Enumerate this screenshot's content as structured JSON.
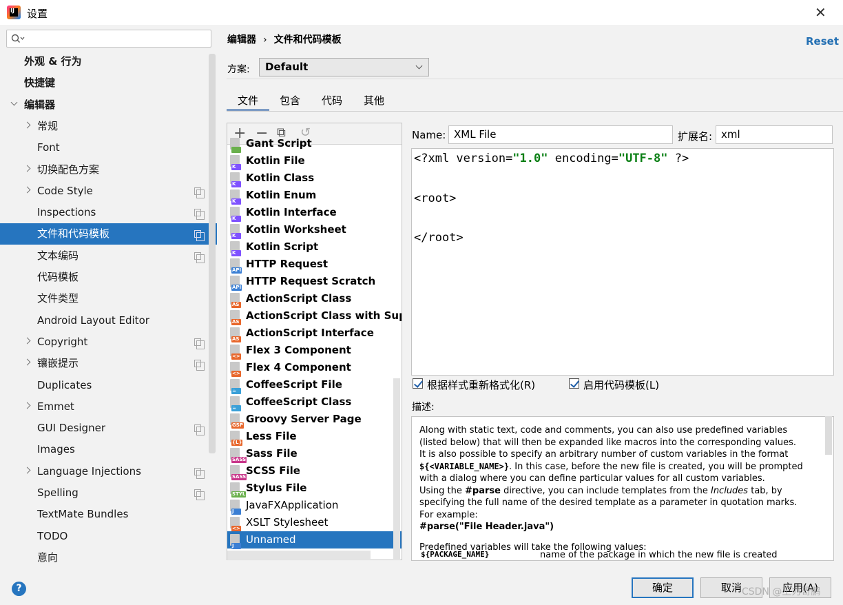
{
  "window": {
    "title": "设置",
    "close": "✕"
  },
  "search": {
    "placeholder": ""
  },
  "sidebar": {
    "items": [
      {
        "label": "外观 & 行为",
        "bold": true
      },
      {
        "label": "快捷键",
        "bold": true
      },
      {
        "label": "编辑器",
        "bold": true,
        "expanded": true
      },
      {
        "label": "常规",
        "expandable": true
      },
      {
        "label": "Font"
      },
      {
        "label": "切换配色方案",
        "expandable": true
      },
      {
        "label": "Code Style",
        "expandable": true,
        "copy": true
      },
      {
        "label": "Inspections",
        "copy": true
      },
      {
        "label": "文件和代码模板",
        "copy": true,
        "selected": true
      },
      {
        "label": "文本编码",
        "copy": true
      },
      {
        "label": "代码模板"
      },
      {
        "label": "文件类型"
      },
      {
        "label": "Android Layout Editor"
      },
      {
        "label": "Copyright",
        "expandable": true,
        "copy": true
      },
      {
        "label": "镶嵌提示",
        "expandable": true,
        "copy": true
      },
      {
        "label": "Duplicates"
      },
      {
        "label": "Emmet",
        "expandable": true
      },
      {
        "label": "GUI Designer",
        "copy": true
      },
      {
        "label": "Images"
      },
      {
        "label": "Language Injections",
        "expandable": true,
        "copy": true
      },
      {
        "label": "Spelling",
        "copy": true
      },
      {
        "label": "TextMate Bundles"
      },
      {
        "label": "TODO"
      },
      {
        "label": "意向"
      }
    ]
  },
  "breadcrumb": {
    "parent": "编辑器",
    "sep": "›",
    "current": "文件和代码模板"
  },
  "reset": "Reset",
  "scheme": {
    "label": "方案:",
    "value": "Default"
  },
  "tabs": [
    "文件",
    "包含",
    "代码",
    "其他"
  ],
  "templates": [
    {
      "name": "Gant Script",
      "badge": "",
      "color": "#6ab04c"
    },
    {
      "name": "Kotlin File",
      "badge": "K",
      "color": "#7f52ff"
    },
    {
      "name": "Kotlin Class",
      "badge": "K",
      "color": "#7f52ff"
    },
    {
      "name": "Kotlin Enum",
      "badge": "K",
      "color": "#7f52ff"
    },
    {
      "name": "Kotlin Interface",
      "badge": "K",
      "color": "#7f52ff"
    },
    {
      "name": "Kotlin Worksheet",
      "badge": "K",
      "color": "#7f52ff"
    },
    {
      "name": "Kotlin Script",
      "badge": "K",
      "color": "#7f52ff"
    },
    {
      "name": "HTTP Request",
      "badge": "API",
      "color": "#3b7fd4"
    },
    {
      "name": "HTTP Request Scratch",
      "badge": "API",
      "color": "#3b7fd4"
    },
    {
      "name": "ActionScript Class",
      "badge": "AS",
      "color": "#e8672c"
    },
    {
      "name": "ActionScript Class with Supers",
      "badge": "AS",
      "color": "#e8672c"
    },
    {
      "name": "ActionScript Interface",
      "badge": "AS",
      "color": "#e8672c"
    },
    {
      "name": "Flex 3 Component",
      "badge": "<>",
      "color": "#e8672c"
    },
    {
      "name": "Flex 4 Component",
      "badge": "<>",
      "color": "#e8672c"
    },
    {
      "name": "CoffeeScript File",
      "badge": "☕",
      "color": "#3aa0d8"
    },
    {
      "name": "CoffeeScript Class",
      "badge": "☕",
      "color": "#3aa0d8"
    },
    {
      "name": "Groovy Server Page",
      "badge": "GSP",
      "color": "#e8672c"
    },
    {
      "name": "Less File",
      "badge": "{L}",
      "color": "#e8672c"
    },
    {
      "name": "Sass File",
      "badge": "SASS",
      "color": "#c9388b"
    },
    {
      "name": "SCSS File",
      "badge": "SASS",
      "color": "#c9388b"
    },
    {
      "name": "Stylus File",
      "badge": "STYL",
      "color": "#6ab04c"
    },
    {
      "name": "JavaFXApplication",
      "badge": "J",
      "color": "#3b7fd4",
      "plain": true
    },
    {
      "name": "XSLT Stylesheet",
      "badge": "<>",
      "color": "#e8672c",
      "plain": true
    },
    {
      "name": "Unnamed",
      "badge": "J",
      "color": "#3b7fd4",
      "plain": true,
      "selected": true
    }
  ],
  "toolbar": {
    "add": "+",
    "remove": "−",
    "copy": "⧉",
    "undo": "↺"
  },
  "form": {
    "name_label": "Name:",
    "name_value": "XML File",
    "ext_label": "扩展名:",
    "ext_value": "xml"
  },
  "editor": {
    "line1_a": "<?xml version=",
    "line1_v1": "\"1.0\"",
    "line1_b": " encoding=",
    "line1_v2": "\"UTF-8\"",
    "line1_c": " ?>",
    "line2": "<root>",
    "line3": "</root>"
  },
  "options": {
    "reformat": "根据样式重新格式化(R)",
    "enable_live": "启用代码模板(L)"
  },
  "description": {
    "label": "描述:",
    "p1a": "Along with static text, code and comments, you can also use predefined variables (listed below) that will then be expanded like macros into the corresponding values.",
    "p2a": "It is also possible to specify an arbitrary number of custom variables in the format ",
    "p2var": "${<VARIABLE_NAME>}",
    "p2b": ". In this case, before the new file is created, you will be prompted with a dialog where you can define particular values for all custom variables.",
    "p3a": "Using the ",
    "p3parse": "#parse",
    "p3b": " directive, you can include templates from the ",
    "p3inc": "Includes",
    "p3c": " tab, by specifying the full name of the desired template as a parameter in quotation marks. For example:",
    "p3ex": "#parse(\"File Header.java\")",
    "p4": "Predefined variables will take the following values:",
    "var1_name": "${PACKAGE_NAME}",
    "var1_desc": "name of the package in which the new file is created"
  },
  "buttons": {
    "ok": "确定",
    "cancel": "取消",
    "apply": "应用(A)",
    "help": "?"
  },
  "watermark": "CSDN @王力哥鹏"
}
